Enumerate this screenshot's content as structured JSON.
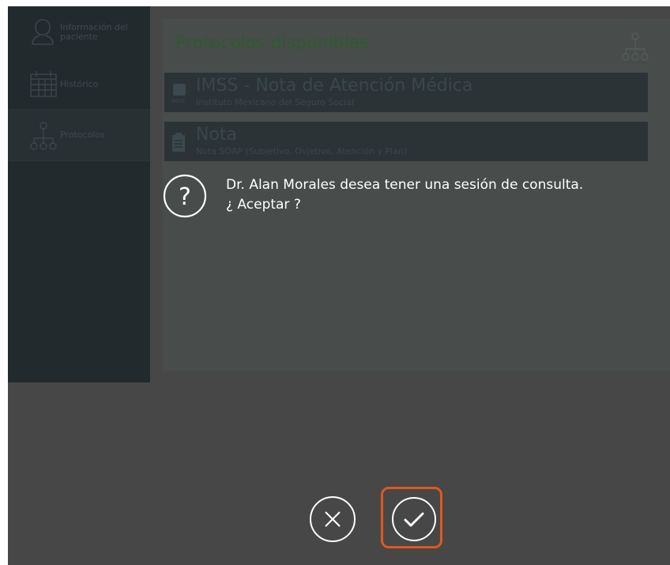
{
  "sidebar": {
    "items": [
      {
        "label": "Información del paciente",
        "icon": "user-icon"
      },
      {
        "label": "Histórico",
        "icon": "calendar-icon"
      },
      {
        "label": "Protocolos",
        "icon": "protocol-tree-icon"
      }
    ]
  },
  "panel": {
    "title": "Protocolos disponibles",
    "icon": "protocol-tree-icon"
  },
  "protocols": [
    {
      "title": "IMSS - Nota de Atención Médica",
      "subtitle": "Instituto Mexicano del Seguro Social",
      "icon": "imss-logo",
      "icon_label": "IMSS"
    },
    {
      "title": "Nota",
      "subtitle": "Nota SOAP (Subjetivo, Ovjetivo, Atención y Plan)",
      "icon": "clipboard-icon"
    }
  ],
  "dialog": {
    "icon": "question-icon",
    "icon_glyph": "?",
    "message": "Dr. Alan Morales desea tener una sesión de consulta. ¿ Aceptar ?",
    "reject": {
      "icon": "close-icon"
    },
    "accept": {
      "icon": "check-icon"
    }
  },
  "colors": {
    "overlay_bg": "#474747",
    "sidebar_bg": "#232a2d",
    "card_bg": "#2b3337",
    "panel_title": "#2e5a2f",
    "accept_highlight": "#e0581f",
    "dialog_text": "#ffffff"
  }
}
